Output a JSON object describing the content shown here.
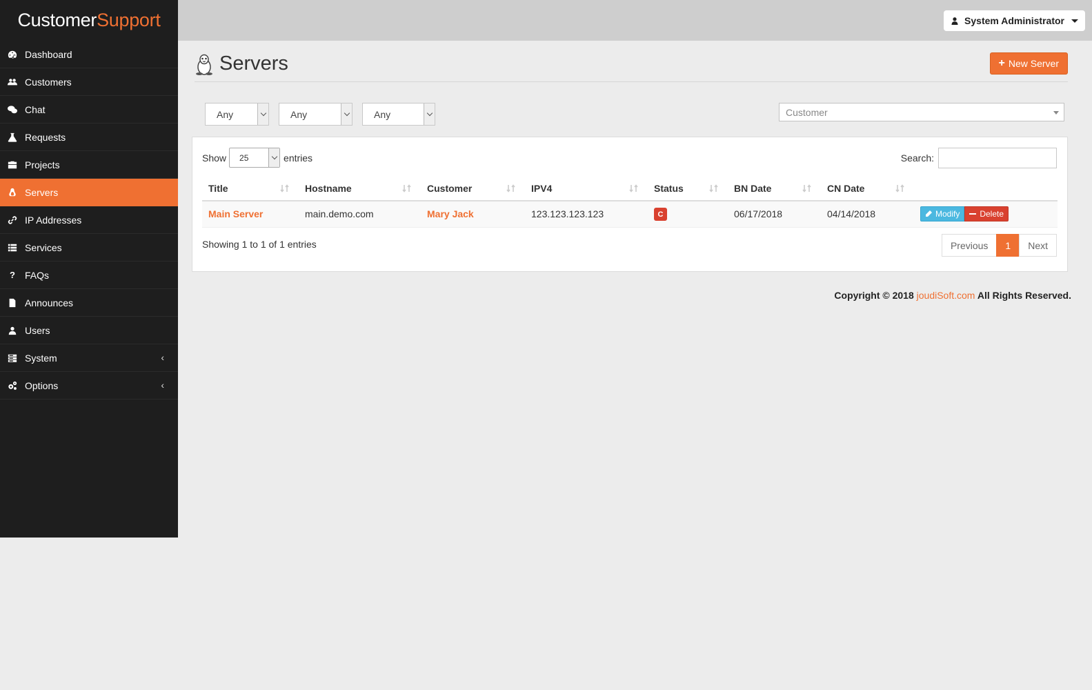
{
  "brand": {
    "part1": "Customer",
    "part2": "Support"
  },
  "sidebar": {
    "items": [
      {
        "label": "Dashboard",
        "icon": "dashboard-icon"
      },
      {
        "label": "Customers",
        "icon": "users-icon"
      },
      {
        "label": "Chat",
        "icon": "chat-icon"
      },
      {
        "label": "Requests",
        "icon": "flask-icon"
      },
      {
        "label": "Projects",
        "icon": "briefcase-icon"
      },
      {
        "label": "Servers",
        "icon": "linux-icon",
        "active": true
      },
      {
        "label": "IP Addresses",
        "icon": "link-icon"
      },
      {
        "label": "Services",
        "icon": "list-icon"
      },
      {
        "label": "FAQs",
        "icon": "question-icon"
      },
      {
        "label": "Announces",
        "icon": "file-icon"
      },
      {
        "label": "Users",
        "icon": "user-icon"
      },
      {
        "label": "System",
        "icon": "server-icon",
        "arrow": "‹"
      },
      {
        "label": "Options",
        "icon": "cogs-icon",
        "arrow": "‹"
      }
    ]
  },
  "topbar": {
    "user": "System Administrator"
  },
  "page": {
    "title": "Servers",
    "new_button": "New Server"
  },
  "filters": {
    "f1": "Any",
    "f2": "Any",
    "f3": "Any",
    "customer_placeholder": "Customer"
  },
  "table_controls": {
    "show": "Show",
    "length": "25",
    "entries": "entries",
    "search_label": "Search:"
  },
  "table": {
    "headers": [
      "Title",
      "Hostname",
      "Customer",
      "IPV4",
      "Status",
      "BN Date",
      "CN Date"
    ],
    "rows": [
      {
        "title": "Main Server",
        "hostname": "main.demo.com",
        "customer": "Mary Jack",
        "ipv4": "123.123.123.123",
        "status": "C",
        "bn_date": "06/17/2018",
        "cn_date": "04/14/2018"
      }
    ],
    "modify_label": "Modify",
    "delete_label": "Delete"
  },
  "info": "Showing 1 to 1 of 1 entries",
  "pagination": {
    "previous": "Previous",
    "current": "1",
    "next": "Next"
  },
  "footer": {
    "prefix": "Copyright © 2018",
    "link": "joudiSoft.com",
    "suffix": "All Rights Reserved."
  },
  "colors": {
    "accent": "#ef7032",
    "sidebar": "#1e1e1e",
    "danger": "#d9412f",
    "info": "#4bb8e0"
  }
}
